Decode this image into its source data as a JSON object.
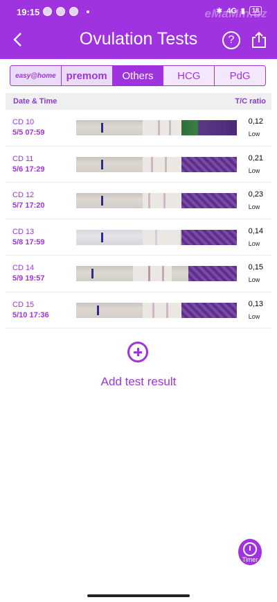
{
  "status": {
    "time": "19:15",
    "network": "4G",
    "battery": "18",
    "watermark": "eMaMin.uz"
  },
  "header": {
    "title": "Ovulation Tests",
    "accent": "#a033e0"
  },
  "tabs": [
    {
      "label": "easy@home",
      "active": false
    },
    {
      "label": "premom",
      "active": false
    },
    {
      "label": "Others",
      "active": true
    },
    {
      "label": "HCG",
      "active": false
    },
    {
      "label": "PdG",
      "active": false
    }
  ],
  "table": {
    "col_date": "Date & Time",
    "col_ratio": "T/C ratio",
    "rows": [
      {
        "cd": "CD 10",
        "datetime": "5/5  07:59",
        "ratio": "0,12",
        "level": "Low"
      },
      {
        "cd": "CD 11",
        "datetime": "5/6  17:29",
        "ratio": "0,21",
        "level": "Low"
      },
      {
        "cd": "CD 12",
        "datetime": "5/7  17:20",
        "ratio": "0,23",
        "level": "Low"
      },
      {
        "cd": "CD 13",
        "datetime": "5/8  17:59",
        "ratio": "0,14",
        "level": "Low"
      },
      {
        "cd": "CD 14",
        "datetime": "5/9  19:57",
        "ratio": "0,15",
        "level": "Low"
      },
      {
        "cd": "CD 15",
        "datetime": "5/10  17:36",
        "ratio": "0,13",
        "level": "Low"
      }
    ]
  },
  "add": {
    "label": "Add test result"
  },
  "timer": {
    "label": "Timer"
  }
}
